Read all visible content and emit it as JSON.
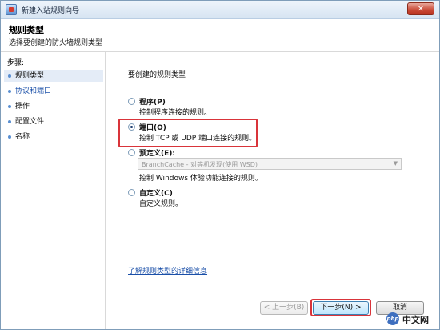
{
  "window": {
    "title": "新建入站规则向导",
    "close_label": "✕"
  },
  "header": {
    "title": "规则类型",
    "subtitle": "选择要创建的防火墙规则类型"
  },
  "sidebar": {
    "steps_label": "步骤:",
    "items": [
      {
        "label": "规则类型",
        "state": "active"
      },
      {
        "label": "协议和端口",
        "state": "link"
      },
      {
        "label": "操作",
        "state": "normal"
      },
      {
        "label": "配置文件",
        "state": "normal"
      },
      {
        "label": "名称",
        "state": "normal"
      }
    ]
  },
  "main": {
    "question": "要创建的规则类型",
    "options": [
      {
        "title": "程序(P)",
        "desc": "控制程序连接的规则。",
        "selected": false
      },
      {
        "title": "端口(O)",
        "desc": "控制 TCP 或 UDP 端口连接的规则。",
        "selected": true
      },
      {
        "title": "预定义(E):",
        "desc": "控制 Windows 体验功能连接的规则。",
        "selected": false
      },
      {
        "title": "自定义(C)",
        "desc": "自定义规则。",
        "selected": false
      }
    ],
    "predefined_value": "BranchCache - 对等机发现(使用 WSD)",
    "learn_link": "了解规则类型的详细信息"
  },
  "footer": {
    "back_label": "< 上一步(B)",
    "next_label": "下一步(N) >",
    "cancel_label": "取消"
  },
  "watermark": {
    "logo_text": "php",
    "site_text": "中文网"
  },
  "colors": {
    "highlight": "#d9343a",
    "link": "#1a4fa8",
    "accent": "#5a8fd1"
  }
}
